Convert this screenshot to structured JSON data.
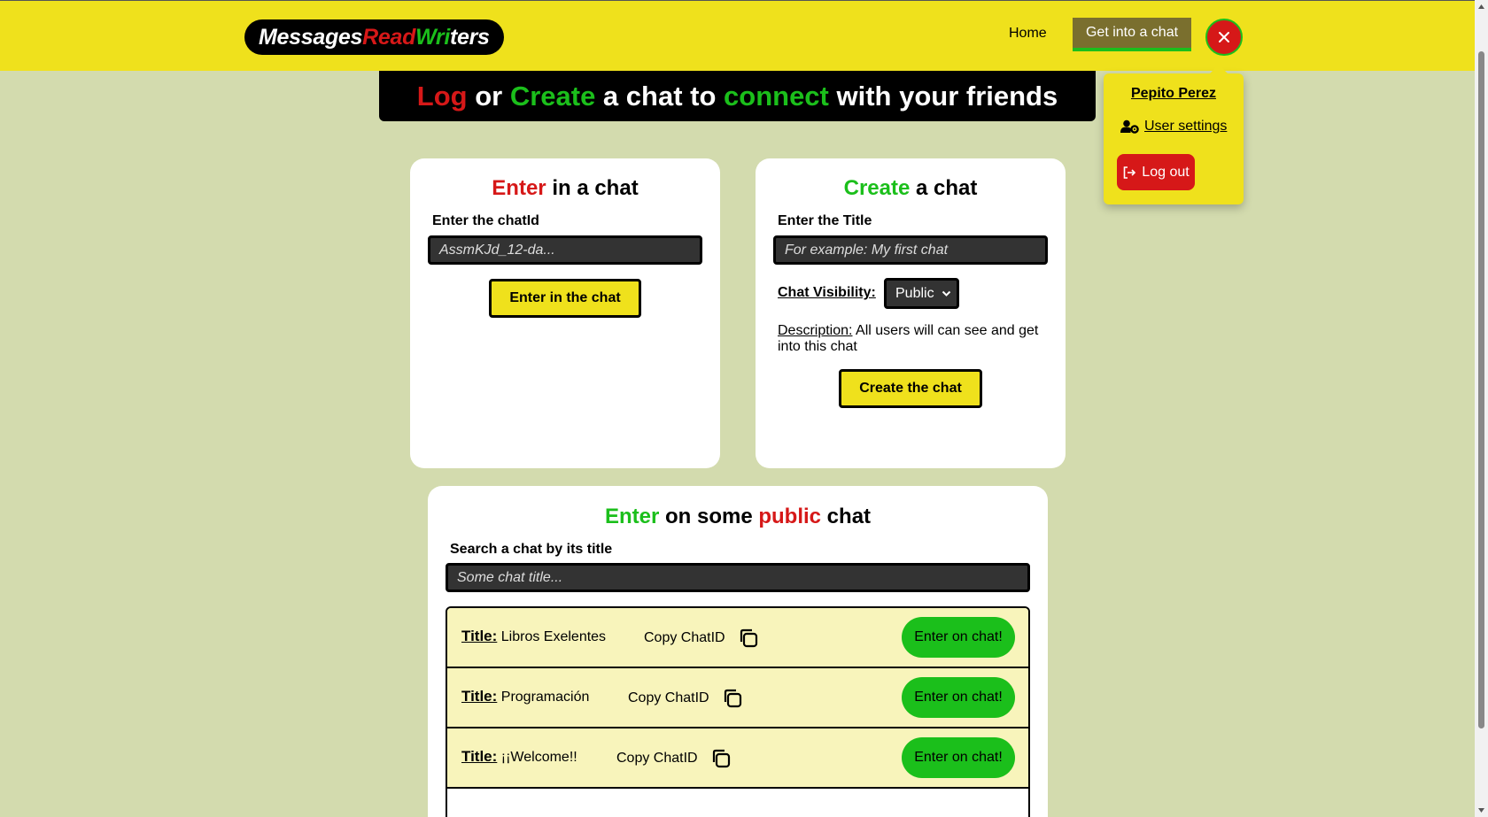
{
  "header": {
    "logo": {
      "part1": "Messages ",
      "part2": "Read",
      "part3": "Wri",
      "part4": "ters"
    },
    "nav": {
      "home": "Home",
      "active": "Get into a chat"
    }
  },
  "user_menu": {
    "name": "Pepito Perez",
    "settings": "User settings",
    "logout": "Log out"
  },
  "banner": {
    "w1": "Log",
    "w2": " or ",
    "w3": "Create",
    "w4": " a chat to ",
    "w5": "connect",
    "w6": " with your friends"
  },
  "enter_card": {
    "title_a": "Enter",
    "title_b": " in a chat",
    "label": "Enter the chatId",
    "placeholder": "AssmKJd_12-da...",
    "button": "Enter in the chat"
  },
  "create_card": {
    "title_a": "Create",
    "title_b": " a chat",
    "label": "Enter the Title",
    "placeholder": "For example: My first chat",
    "visibility_label": "Chat Visibility:",
    "visibility_value": "Public",
    "desc_label": "Description:",
    "desc_text": " All users will can see and get into this chat",
    "button": "Create the chat"
  },
  "public_card": {
    "title_a": "Enter",
    "title_b": " on some ",
    "title_c": "public",
    "title_d": " chat",
    "label": "Search a chat by its title",
    "placeholder": "Some chat title...",
    "title_prefix": "Title:",
    "copy_label": "Copy ChatID",
    "enter_label": "Enter on chat!",
    "chats": [
      {
        "title": "Libros Exelentes"
      },
      {
        "title": "Programación"
      },
      {
        "title": "¡¡Welcome!!"
      }
    ]
  },
  "colors": {
    "yellow": "#efe11c",
    "red": "#d61818",
    "green": "#1bbf1b",
    "background": "#d3dbae"
  }
}
